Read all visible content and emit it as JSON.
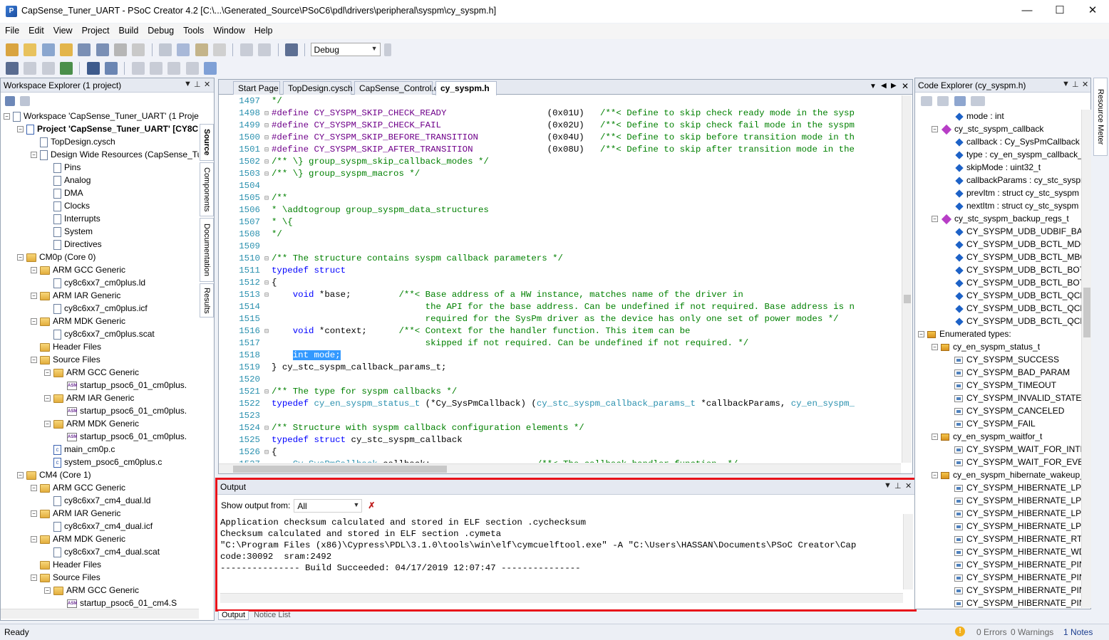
{
  "window": {
    "title": "CapSense_Tuner_UART - PSoC Creator 4.2  [C:\\...\\Generated_Source\\PSoC6\\pdl\\drivers\\peripheral\\syspm\\cy_syspm.h]",
    "minimize": "—",
    "maximize": "☐",
    "close": "✕"
  },
  "menu": [
    "File",
    "Edit",
    "View",
    "Project",
    "Build",
    "Debug",
    "Tools",
    "Window",
    "Help"
  ],
  "toolbar": {
    "config_value": "Debug"
  },
  "workspace": {
    "title": "Workspace Explorer (1 project)",
    "tabs": [
      "Source",
      "Components",
      "Documentation",
      "Results"
    ],
    "nodes": [
      {
        "t": "Workspace 'CapSense_Tuner_UART' (1 Project",
        "lvl": 0,
        "icon": "workspace",
        "exp": "−"
      },
      {
        "t": "Project 'CapSense_Tuner_UART' [CY8C",
        "lvl": 1,
        "icon": "project",
        "exp": "−",
        "bold": true
      },
      {
        "t": "TopDesign.cysch",
        "lvl": 2,
        "icon": "file"
      },
      {
        "t": "Design Wide Resources (CapSense_Tur",
        "lvl": 2,
        "icon": "gear",
        "exp": "−"
      },
      {
        "t": "Pins",
        "lvl": 3,
        "icon": "pins"
      },
      {
        "t": "Analog",
        "lvl": 3,
        "icon": "analog"
      },
      {
        "t": "DMA",
        "lvl": 3,
        "icon": "dma"
      },
      {
        "t": "Clocks",
        "lvl": 3,
        "icon": "clock"
      },
      {
        "t": "Interrupts",
        "lvl": 3,
        "icon": "interrupt"
      },
      {
        "t": "System",
        "lvl": 3,
        "icon": "system"
      },
      {
        "t": "Directives",
        "lvl": 3,
        "icon": "file"
      },
      {
        "t": "CM0p (Core 0)",
        "lvl": 1,
        "icon": "folder",
        "exp": "−"
      },
      {
        "t": "ARM GCC Generic",
        "lvl": 2,
        "icon": "folder",
        "exp": "−"
      },
      {
        "t": "cy8c6xx7_cm0plus.ld",
        "lvl": 3,
        "icon": "file"
      },
      {
        "t": "ARM IAR Generic",
        "lvl": 2,
        "icon": "folder",
        "exp": "−"
      },
      {
        "t": "cy8c6xx7_cm0plus.icf",
        "lvl": 3,
        "icon": "file"
      },
      {
        "t": "ARM MDK Generic",
        "lvl": 2,
        "icon": "folder",
        "exp": "−"
      },
      {
        "t": "cy8c6xx7_cm0plus.scat",
        "lvl": 3,
        "icon": "file"
      },
      {
        "t": "Header Files",
        "lvl": 2,
        "icon": "folder"
      },
      {
        "t": "Source Files",
        "lvl": 2,
        "icon": "folder",
        "exp": "−"
      },
      {
        "t": "ARM GCC Generic",
        "lvl": 3,
        "icon": "folder",
        "exp": "−"
      },
      {
        "t": "startup_psoc6_01_cm0plus.",
        "lvl": 4,
        "icon": "asm"
      },
      {
        "t": "ARM IAR Generic",
        "lvl": 3,
        "icon": "folder",
        "exp": "−"
      },
      {
        "t": "startup_psoc6_01_cm0plus.",
        "lvl": 4,
        "icon": "asm"
      },
      {
        "t": "ARM MDK Generic",
        "lvl": 3,
        "icon": "folder",
        "exp": "−"
      },
      {
        "t": "startup_psoc6_01_cm0plus.",
        "lvl": 4,
        "icon": "asm"
      },
      {
        "t": "main_cm0p.c",
        "lvl": 3,
        "icon": "c"
      },
      {
        "t": "system_psoc6_cm0plus.c",
        "lvl": 3,
        "icon": "c"
      },
      {
        "t": "CM4 (Core 1)",
        "lvl": 1,
        "icon": "folder",
        "exp": "−"
      },
      {
        "t": "ARM GCC Generic",
        "lvl": 2,
        "icon": "folder",
        "exp": "−"
      },
      {
        "t": "cy8c6xx7_cm4_dual.ld",
        "lvl": 3,
        "icon": "file"
      },
      {
        "t": "ARM IAR Generic",
        "lvl": 2,
        "icon": "folder",
        "exp": "−"
      },
      {
        "t": "cy8c6xx7_cm4_dual.icf",
        "lvl": 3,
        "icon": "file"
      },
      {
        "t": "ARM MDK Generic",
        "lvl": 2,
        "icon": "folder",
        "exp": "−"
      },
      {
        "t": "cy8c6xx7_cm4_dual.scat",
        "lvl": 3,
        "icon": "file"
      },
      {
        "t": "Header Files",
        "lvl": 2,
        "icon": "folder"
      },
      {
        "t": "Source Files",
        "lvl": 2,
        "icon": "folder",
        "exp": "−"
      },
      {
        "t": "ARM GCC Generic",
        "lvl": 3,
        "icon": "folder",
        "exp": "−"
      },
      {
        "t": "startup_psoc6_01_cm4.S",
        "lvl": 4,
        "icon": "asm"
      }
    ]
  },
  "editor": {
    "tabs": [
      "Start Page",
      "TopDesign.cysch",
      "CapSense_Control.c",
      "cy_syspm.h"
    ],
    "active_tab": 3,
    "lines": [
      {
        "n": "1497",
        "f": "",
        "segs": [
          [
            "cm",
            "*/"
          ]
        ]
      },
      {
        "n": "1498",
        "f": "⊟",
        "segs": [
          [
            "mac",
            "#define CY_SYSPM_SKIP_CHECK_READY"
          ],
          [
            "",
            "                   (0x01U)   "
          ],
          [
            "cm",
            "/**< Define to skip check ready mode in the sysp"
          ]
        ]
      },
      {
        "n": "1499",
        "f": "⊟",
        "segs": [
          [
            "mac",
            "#define CY_SYSPM_SKIP_CHECK_FAIL"
          ],
          [
            "",
            "                    (0x02U)   "
          ],
          [
            "cm",
            "/**< Define to skip check fail mode in the syspm"
          ]
        ]
      },
      {
        "n": "1500",
        "f": "⊟",
        "segs": [
          [
            "mac",
            "#define CY_SYSPM_SKIP_BEFORE_TRANSITION"
          ],
          [
            "",
            "             (0x04U)   "
          ],
          [
            "cm",
            "/**< Define to skip before transition mode in th"
          ]
        ]
      },
      {
        "n": "1501",
        "f": "⊟",
        "segs": [
          [
            "mac",
            "#define CY_SYSPM_SKIP_AFTER_TRANSITION"
          ],
          [
            "",
            "              (0x08U)   "
          ],
          [
            "cm",
            "/**< Define to skip after transition mode in the"
          ]
        ]
      },
      {
        "n": "1502",
        "f": "⊟",
        "segs": [
          [
            "cm",
            "/** \\} group_syspm_skip_callback_modes */"
          ]
        ]
      },
      {
        "n": "1503",
        "f": "⊟",
        "segs": [
          [
            "cm",
            "/** \\} group_syspm_macros */"
          ]
        ]
      },
      {
        "n": "1504",
        "f": "",
        "segs": [
          [
            "",
            ""
          ]
        ]
      },
      {
        "n": "1505",
        "f": "⊟",
        "segs": [
          [
            "cm",
            "/**"
          ]
        ]
      },
      {
        "n": "1506",
        "f": "",
        "segs": [
          [
            "cm",
            "* \\addtogroup group_syspm_data_structures"
          ]
        ]
      },
      {
        "n": "1507",
        "f": "",
        "segs": [
          [
            "cm",
            "* \\{"
          ]
        ]
      },
      {
        "n": "1508",
        "f": "",
        "segs": [
          [
            "cm",
            "*/"
          ]
        ]
      },
      {
        "n": "1509",
        "f": "",
        "segs": [
          [
            "",
            ""
          ]
        ]
      },
      {
        "n": "1510",
        "f": "⊟",
        "segs": [
          [
            "cm",
            "/** The structure contains syspm callback parameters */"
          ]
        ]
      },
      {
        "n": "1511",
        "f": "",
        "segs": [
          [
            "kw",
            "typedef struct"
          ]
        ]
      },
      {
        "n": "1512",
        "f": "⊟",
        "segs": [
          [
            "",
            "{"
          ]
        ]
      },
      {
        "n": "1513",
        "f": "⊟",
        "segs": [
          [
            "",
            "    "
          ],
          [
            "kw",
            "void"
          ],
          [
            "",
            " *base;         "
          ],
          [
            "cm",
            "/**< Base address of a HW instance, matches name of the driver in"
          ]
        ]
      },
      {
        "n": "1514",
        "f": "",
        "segs": [
          [
            "cm",
            "                             the API for the base address. Can be undefined if not required. Base address is n"
          ]
        ]
      },
      {
        "n": "1515",
        "f": "",
        "segs": [
          [
            "cm",
            "                             required for the SysPm driver as the device has only one set of power modes */"
          ]
        ]
      },
      {
        "n": "1516",
        "f": "⊟",
        "segs": [
          [
            "",
            "    "
          ],
          [
            "kw",
            "void"
          ],
          [
            "",
            " *context;      "
          ],
          [
            "cm",
            "/**< Context for the handler function. This item can be"
          ]
        ]
      },
      {
        "n": "1517",
        "f": "",
        "segs": [
          [
            "cm",
            "                             skipped if not required. Can be undefined if not required. */"
          ]
        ]
      },
      {
        "n": "1518",
        "f": "",
        "segs": [
          [
            "",
            "    "
          ],
          [
            "hl",
            "int mode;"
          ]
        ]
      },
      {
        "n": "1519",
        "f": "",
        "segs": [
          [
            "",
            "} cy_stc_syspm_callback_params_t;"
          ]
        ]
      },
      {
        "n": "1520",
        "f": "",
        "segs": [
          [
            "",
            ""
          ]
        ]
      },
      {
        "n": "1521",
        "f": "⊟",
        "segs": [
          [
            "cm",
            "/** The type for syspm callbacks */"
          ]
        ]
      },
      {
        "n": "1522",
        "f": "",
        "segs": [
          [
            "kw",
            "typedef"
          ],
          [
            "",
            " "
          ],
          [
            "ty",
            "cy_en_syspm_status_t"
          ],
          [
            "",
            " (*Cy_SysPmCallback) ("
          ],
          [
            "ty",
            "cy_stc_syspm_callback_params_t"
          ],
          [
            "",
            " *callbackParams, "
          ],
          [
            "ty",
            "cy_en_syspm_"
          ]
        ]
      },
      {
        "n": "1523",
        "f": "",
        "segs": [
          [
            "",
            ""
          ]
        ]
      },
      {
        "n": "1524",
        "f": "⊟",
        "segs": [
          [
            "cm",
            "/** Structure with syspm callback configuration elements */"
          ]
        ]
      },
      {
        "n": "1525",
        "f": "",
        "segs": [
          [
            "kw",
            "typedef struct"
          ],
          [
            "",
            " cy_stc_syspm_callback"
          ]
        ]
      },
      {
        "n": "1526",
        "f": "⊟",
        "segs": [
          [
            "",
            "{"
          ]
        ]
      },
      {
        "n": "1527",
        "f": "",
        "segs": [
          [
            "",
            "    "
          ],
          [
            "ty",
            "Cy_SysPmCallback"
          ],
          [
            "",
            " callback;                    "
          ],
          [
            "cm",
            "/**< The callback handler function. */"
          ]
        ]
      }
    ]
  },
  "output": {
    "title": "Output",
    "show_from_label": "Show output from:",
    "show_from_value": "All",
    "lines": [
      "Application checksum calculated and stored in ELF section .cychecksum",
      "Checksum calculated and stored in ELF section .cymeta",
      "\"C:\\Program Files (x86)\\Cypress\\PDL\\3.1.0\\tools\\win\\elf\\cymcuelftool.exe\" -A \"C:\\Users\\HASSAN\\Documents\\PSoC Creator\\Cap",
      "code:30092  sram:2492",
      "--------------- Build Succeeded: 04/17/2019 12:07:47 ---------------"
    ],
    "bottom_tabs": [
      "Output",
      "Notice List"
    ]
  },
  "code_explorer": {
    "title": "Code Explorer (cy_syspm.h)",
    "side_tab": "Resource Meter",
    "nodes": [
      {
        "t": "mode : int",
        "lvl": 3,
        "icon": "member"
      },
      {
        "t": "cy_stc_syspm_callback",
        "lvl": 2,
        "icon": "struct",
        "exp": "−"
      },
      {
        "t": "callback : Cy_SysPmCallback",
        "lvl": 3,
        "icon": "member"
      },
      {
        "t": "type : cy_en_syspm_callback_",
        "lvl": 3,
        "icon": "member"
      },
      {
        "t": "skipMode : uint32_t",
        "lvl": 3,
        "icon": "member"
      },
      {
        "t": "callbackParams : cy_stc_syspr",
        "lvl": 3,
        "icon": "member"
      },
      {
        "t": "prevItm : struct cy_stc_syspm",
        "lvl": 3,
        "icon": "member"
      },
      {
        "t": "nextItm : struct cy_stc_syspm",
        "lvl": 3,
        "icon": "member"
      },
      {
        "t": "cy_stc_syspm_backup_regs_t",
        "lvl": 2,
        "icon": "struct",
        "exp": "−"
      },
      {
        "t": "CY_SYSPM_UDB_UDBIF_BANK",
        "lvl": 3,
        "icon": "member"
      },
      {
        "t": "CY_SYSPM_UDB_BCTL_MDCL",
        "lvl": 3,
        "icon": "member"
      },
      {
        "t": "CY_SYSPM_UDB_BCTL_MBCLI",
        "lvl": 3,
        "icon": "member"
      },
      {
        "t": "CY_SYSPM_UDB_BCTL_BOTSE",
        "lvl": 3,
        "icon": "member"
      },
      {
        "t": "CY_SYSPM_UDB_BCTL_BOTSE",
        "lvl": 3,
        "icon": "member"
      },
      {
        "t": "CY_SYSPM_UDB_BCTL_QCLK_",
        "lvl": 3,
        "icon": "member"
      },
      {
        "t": "CY_SYSPM_UDB_BCTL_QCLK_",
        "lvl": 3,
        "icon": "member"
      },
      {
        "t": "CY_SYSPM_UDB_BCTL_QCLK_",
        "lvl": 3,
        "icon": "member"
      },
      {
        "t": "Enumerated types:",
        "lvl": 1,
        "icon": "enum",
        "exp": "−"
      },
      {
        "t": "cy_en_syspm_status_t",
        "lvl": 2,
        "icon": "enum",
        "exp": "−"
      },
      {
        "t": "CY_SYSPM_SUCCESS",
        "lvl": 3,
        "icon": "enumv"
      },
      {
        "t": "CY_SYSPM_BAD_PARAM",
        "lvl": 3,
        "icon": "enumv"
      },
      {
        "t": "CY_SYSPM_TIMEOUT",
        "lvl": 3,
        "icon": "enumv"
      },
      {
        "t": "CY_SYSPM_INVALID_STATE",
        "lvl": 3,
        "icon": "enumv"
      },
      {
        "t": "CY_SYSPM_CANCELED",
        "lvl": 3,
        "icon": "enumv"
      },
      {
        "t": "CY_SYSPM_FAIL",
        "lvl": 3,
        "icon": "enumv"
      },
      {
        "t": "cy_en_syspm_waitfor_t",
        "lvl": 2,
        "icon": "enum",
        "exp": "−"
      },
      {
        "t": "CY_SYSPM_WAIT_FOR_INTER",
        "lvl": 3,
        "icon": "enumv"
      },
      {
        "t": "CY_SYSPM_WAIT_FOR_EVENT",
        "lvl": 3,
        "icon": "enumv"
      },
      {
        "t": "cy_en_syspm_hibernate_wakeup_",
        "lvl": 2,
        "icon": "enum",
        "exp": "−"
      },
      {
        "t": "CY_SYSPM_HIBERNATE_LPCO",
        "lvl": 3,
        "icon": "enumv"
      },
      {
        "t": "CY_SYSPM_HIBERNATE_LPCO",
        "lvl": 3,
        "icon": "enumv"
      },
      {
        "t": "CY_SYSPM_HIBERNATE_LPCO",
        "lvl": 3,
        "icon": "enumv"
      },
      {
        "t": "CY_SYSPM_HIBERNATE_LPCO",
        "lvl": 3,
        "icon": "enumv"
      },
      {
        "t": "CY_SYSPM_HIBERNATE_RTC_",
        "lvl": 3,
        "icon": "enumv"
      },
      {
        "t": "CY_SYSPM_HIBERNATE_WDT",
        "lvl": 3,
        "icon": "enumv"
      },
      {
        "t": "CY_SYSPM_HIBERNATE_PIN0",
        "lvl": 3,
        "icon": "enumv"
      },
      {
        "t": "CY_SYSPM_HIBERNATE_PIN0",
        "lvl": 3,
        "icon": "enumv"
      },
      {
        "t": "CY_SYSPM_HIBERNATE_PIN1",
        "lvl": 3,
        "icon": "enumv"
      },
      {
        "t": "CY_SYSPM_HIBERNATE_PIN1",
        "lvl": 3,
        "icon": "enumv"
      }
    ]
  },
  "status": {
    "text": "Ready",
    "errors": "0 Errors",
    "warnings": "0 Warnings",
    "notes": "1 Notes"
  },
  "colors": {
    "highlight_border": "#e8121a",
    "keyword": "#0000ff",
    "comment": "#008000",
    "type": "#2b91af",
    "macro": "#6f008a",
    "selection": "#3399ff"
  }
}
